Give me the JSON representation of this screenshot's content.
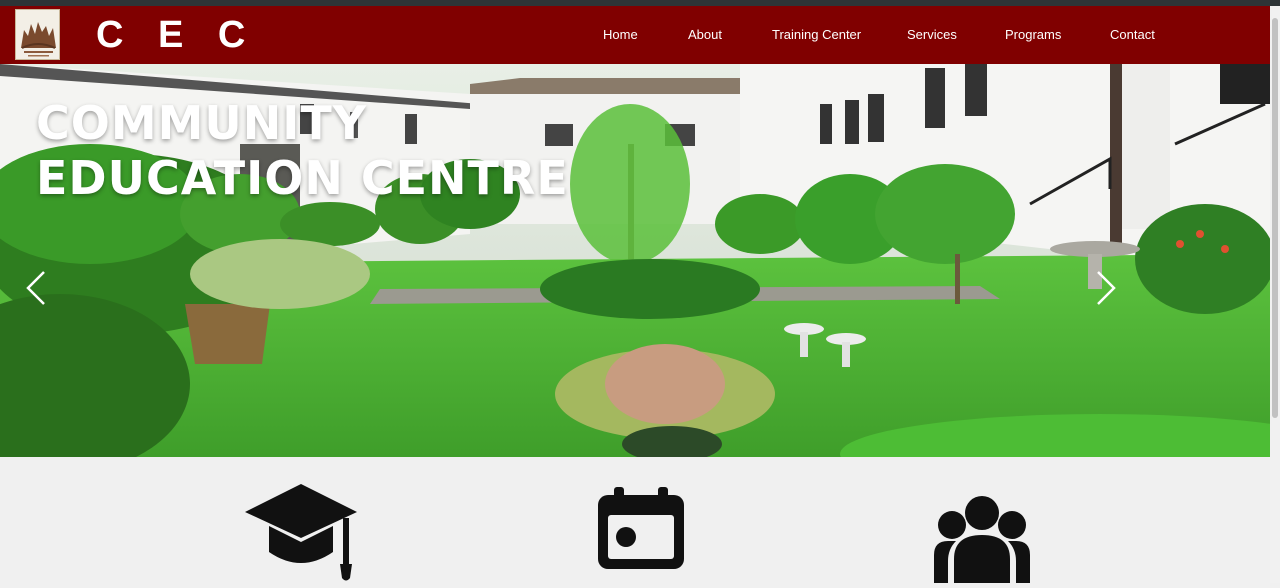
{
  "brand": {
    "logo_icon": "cec-logo-icon",
    "name": "C E C"
  },
  "nav": {
    "items": [
      {
        "label": "Home"
      },
      {
        "label": "About"
      },
      {
        "label": "Training Center"
      },
      {
        "label": "Services"
      },
      {
        "label": "Programs"
      },
      {
        "label": "Contact"
      }
    ]
  },
  "hero": {
    "title_line1": "COMMUNITY",
    "title_line2": "EDUCATION CENTRE",
    "prev_icon": "chevron-left-icon",
    "next_icon": "chevron-right-icon"
  },
  "features": {
    "icons": [
      "graduation-cap-icon",
      "calendar-icon",
      "users-icon"
    ]
  },
  "colors": {
    "navbar": "#800000",
    "topstrip": "#2d3436",
    "features_bg": "#f0f0f0",
    "icon": "#111111"
  }
}
